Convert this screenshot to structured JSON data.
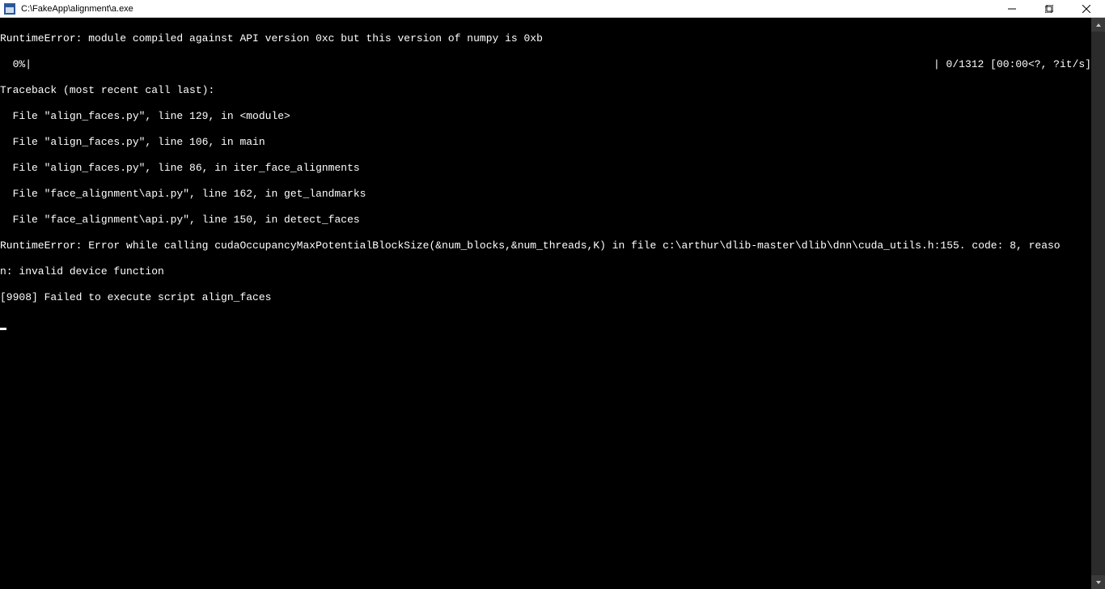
{
  "window": {
    "title": "C:\\FakeApp\\alignment\\a.exe"
  },
  "progress": {
    "left": "  0%|",
    "right": "| 0/1312 [00:00<?, ?it/s]"
  },
  "terminal": {
    "lines": [
      "RuntimeError: module compiled against API version 0xc but this version of numpy is 0xb",
      "Traceback (most recent call last):",
      "  File \"align_faces.py\", line 129, in <module>",
      "  File \"align_faces.py\", line 106, in main",
      "  File \"align_faces.py\", line 86, in iter_face_alignments",
      "  File \"face_alignment\\api.py\", line 162, in get_landmarks",
      "  File \"face_alignment\\api.py\", line 150, in detect_faces",
      "RuntimeError: Error while calling cudaOccupancyMaxPotentialBlockSize(&num_blocks,&num_threads,K) in file c:\\arthur\\dlib-master\\dlib\\dnn\\cuda_utils.h:155. code: 8, reaso",
      "n: invalid device function",
      "[9908] Failed to execute script align_faces"
    ]
  }
}
